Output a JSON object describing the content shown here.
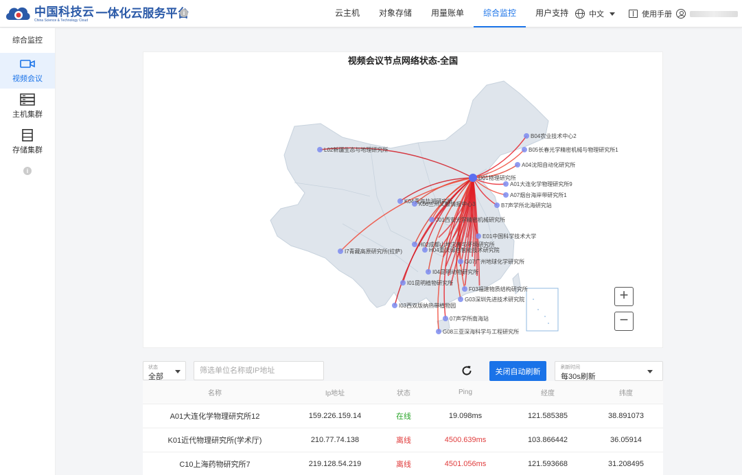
{
  "header": {
    "logo_cn": "中国科技云",
    "logo_en": "China Science & Technology Cloud",
    "platform_title": "一体化云服务平台",
    "nav": [
      {
        "label": "云主机",
        "active": false
      },
      {
        "label": "对象存储",
        "active": false
      },
      {
        "label": "用量账单",
        "active": false
      },
      {
        "label": "综合监控",
        "active": true
      },
      {
        "label": "用户支持",
        "active": false
      }
    ],
    "language": "中文",
    "manual": "使用手册",
    "accent_color": "#1a73e8"
  },
  "sidebar": {
    "title": "综合监控",
    "items": [
      {
        "label": "视频会议",
        "icon": "video-camera-icon",
        "active": true
      },
      {
        "label": "主机集群",
        "icon": "server-icon",
        "active": false
      },
      {
        "label": "存储集群",
        "icon": "storage-icon",
        "active": false
      }
    ]
  },
  "map": {
    "title": "视频会议节点网络状态-全国",
    "hub": "D01物理研究所",
    "nodes": [
      {
        "label": "B04农业技术中心2"
      },
      {
        "label": "B05长春光学精密机械与物理研究所1"
      },
      {
        "label": "L02新疆生态与地理研究所"
      },
      {
        "label": "A04沈阳自动化研究所"
      },
      {
        "label": "A01大连化学物理研究所9"
      },
      {
        "label": "A07烟台海岸带研究所1"
      },
      {
        "label": "K04青海盐湖研究所"
      },
      {
        "label": "K06兰州文献情报中心3"
      },
      {
        "label": "B7声学所北海研究站"
      },
      {
        "label": "J01西安光学精密机械研究所"
      },
      {
        "label": "E01中国科学技术大学"
      },
      {
        "label": "H02成都山地灾害与环境研究所"
      },
      {
        "label": "H04重庆绿色智能技术研究院"
      },
      {
        "label": "I7青藏高原研究所(拉萨)"
      },
      {
        "label": "G07广州地球化学研究所"
      },
      {
        "label": "I04昆明动物研究所"
      },
      {
        "label": "I01昆明植物研究所"
      },
      {
        "label": "F03福建物质结构研究所"
      },
      {
        "label": "I03西双版纳热带植物园"
      },
      {
        "label": "G03深圳先进技术研究院"
      },
      {
        "label": "07声学所南海站"
      },
      {
        "label": "G08三亚深海科学与工程研究所"
      }
    ],
    "zoom_in": "+",
    "zoom_out": "−"
  },
  "filters": {
    "status_label": "状态",
    "status_value": "全部",
    "search_placeholder": "筛选单位名称或IP地址",
    "auto_refresh_button": "关闭自动刷新",
    "refresh_label": "刷新时间",
    "refresh_value": "每30s刷新"
  },
  "table": {
    "headers": [
      "名称",
      "Ip地址",
      "状态",
      "Ping",
      "经度",
      "纬度"
    ],
    "rows": [
      {
        "name": "A01大连化学物理研究所12",
        "ip": "159.226.159.14",
        "status": "在线",
        "ping": "19.098ms",
        "lng": "121.585385",
        "lat": "38.891073",
        "online": true
      },
      {
        "name": "K01近代物理研究所(学术厅)",
        "ip": "210.77.74.138",
        "status": "离线",
        "ping": "4500.639ms",
        "lng": "103.866442",
        "lat": "36.05914",
        "online": false
      },
      {
        "name": "C10上海药物研究所7",
        "ip": "219.128.54.219",
        "status": "离线",
        "ping": "4501.056ms",
        "lng": "121.593668",
        "lat": "31.208495",
        "online": false
      }
    ]
  }
}
